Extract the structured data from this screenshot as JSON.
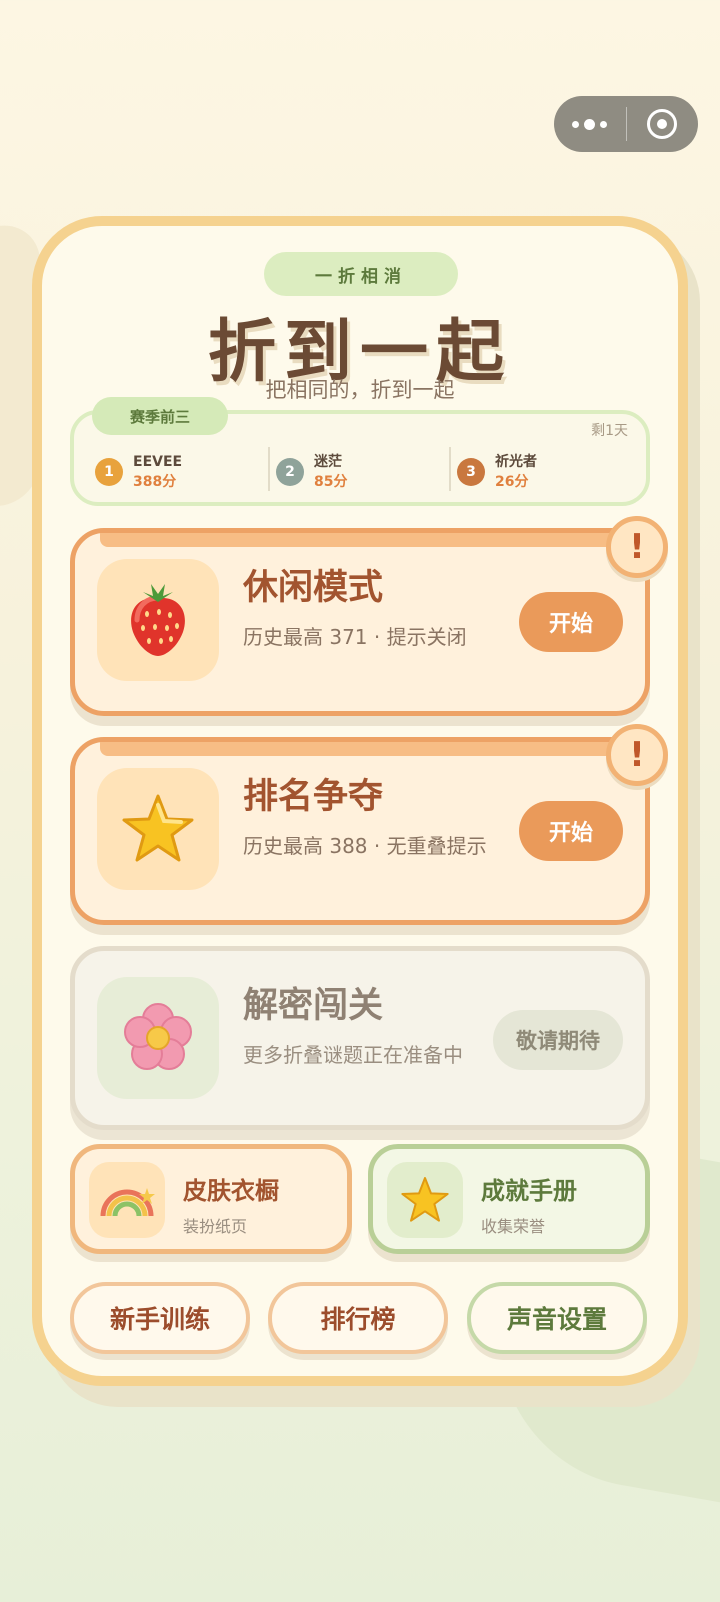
{
  "header": {
    "tag": "一折相消",
    "title": "折到一起",
    "subtitle": "把相同的，折到一起"
  },
  "season": {
    "label": "赛季前三",
    "remaining": "剩1天",
    "ranks": [
      {
        "pos": "1",
        "name": "EEVEE",
        "score": "388分",
        "color": "#e8a23c"
      },
      {
        "pos": "2",
        "name": "迷茫",
        "score": "85分",
        "color": "#8fa39a"
      },
      {
        "pos": "3",
        "name": "祈光者",
        "score": "26分",
        "color": "#c9783f"
      }
    ]
  },
  "modes": [
    {
      "title": "休闲模式",
      "desc": "历史最高 371 · 提示关闭",
      "button": "开始",
      "icon": "strawberry-icon",
      "alert": "!"
    },
    {
      "title": "排名争夺",
      "desc": "历史最高 388 · 无重叠提示",
      "button": "开始",
      "icon": "star-icon",
      "alert": "!"
    },
    {
      "title": "解密闯关",
      "desc": "更多折叠谜题正在准备中",
      "button": "敬请期待",
      "icon": "flower-icon"
    }
  ],
  "cards": {
    "skin": {
      "title": "皮肤衣橱",
      "sub": "装扮纸页",
      "icon": "rainbow-icon"
    },
    "achievement": {
      "title": "成就手册",
      "sub": "收集荣誉",
      "icon": "star-icon"
    }
  },
  "bottom": {
    "tutorial": "新手训练",
    "leaderboard": "排行榜",
    "sound": "声音设置"
  },
  "colors": {
    "accent": "#ea9a5a",
    "green": "#5d7a3c",
    "brown": "#6b4a34"
  }
}
